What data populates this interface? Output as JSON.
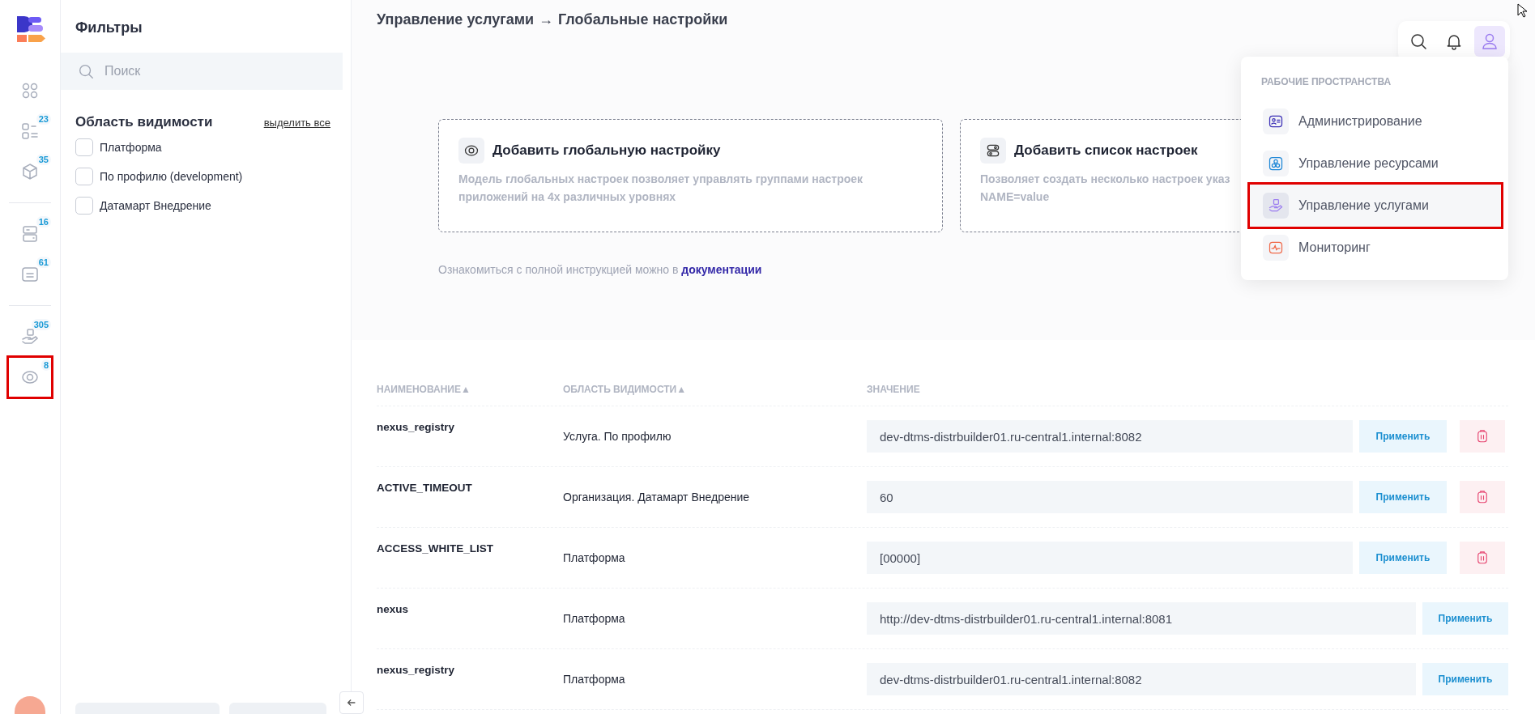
{
  "rail": {
    "groups": [
      [
        {
          "kind": "grid",
          "highlighted": false
        },
        {
          "kind": "list",
          "badge": "23",
          "highlighted": false
        },
        {
          "kind": "cube",
          "badge": "35",
          "highlighted": false
        }
      ],
      [
        {
          "kind": "server",
          "badge": "16",
          "highlighted": false
        },
        {
          "kind": "terminal",
          "badge": "61",
          "highlighted": false
        }
      ],
      [
        {
          "kind": "hand",
          "badge": "305",
          "highlighted": false
        },
        {
          "kind": "eye",
          "badge": "8",
          "highlighted": true
        }
      ]
    ]
  },
  "filters": {
    "title": "Фильтры",
    "search": {
      "placeholder": "Поиск"
    },
    "section": "Область видимости",
    "select_all": "выделить все",
    "options": [
      {
        "label": "Платформа",
        "checked": false
      },
      {
        "label": "По профилю (development)",
        "checked": false
      },
      {
        "label": "Датамарт Внедрение",
        "checked": false
      }
    ]
  },
  "breadcrumb": {
    "parent": "Управление услугами",
    "separator": "→",
    "current": "Глобальные настройки"
  },
  "cards": [
    {
      "kind": "eye",
      "title": "Добавить глобальную настройку",
      "lines": [
        "Модель глобальных настроек позволяет управлять группами настроек",
        "приложений на 4х различных уровнях"
      ]
    },
    {
      "kind": "toggles",
      "title": "Добавить список настроек",
      "lines": [
        "Позволяет создать несколько настроек указ",
        "NAME=value"
      ]
    }
  ],
  "docs": {
    "text": "Ознакомиться с полной инструкцией можно в",
    "link": "документации"
  },
  "toolbar": [
    {
      "kind": "search",
      "selected": false
    },
    {
      "kind": "bell",
      "selected": false
    },
    {
      "kind": "user",
      "selected": true
    }
  ],
  "menu": {
    "section": "РАБОЧИЕ ПРОСТРАНСТВА",
    "items": [
      {
        "kind": "admin",
        "label": "Администрирование",
        "selected": false,
        "highlighted": false
      },
      {
        "kind": "resources",
        "label": "Управление ресурсами",
        "selected": false,
        "highlighted": false
      },
      {
        "kind": "services",
        "label": "Управление услугами",
        "selected": true,
        "highlighted": true
      },
      {
        "kind": "monitoring",
        "label": "Мониторинг",
        "selected": false,
        "highlighted": false
      }
    ]
  },
  "table": {
    "columns": [
      {
        "label": "НАИМЕНОВАНИЕ",
        "sort": "▲"
      },
      {
        "label": "ОБЛАСТЬ ВИДИМОСТИ",
        "sort": "▲"
      },
      {
        "label": "ЗНАЧЕНИЕ"
      }
    ],
    "rows": [
      {
        "name": "nexus_registry",
        "scope": "Услуга. По профилю",
        "value": "dev-dtms-distrbuilder01.ru-central1.internal:8082",
        "apply": "Применить",
        "deletable": true
      },
      {
        "name": "ACTIVE_TIMEOUT",
        "scope": "Организация. Датамарт Внедрение",
        "value": "60",
        "apply": "Применить",
        "deletable": true
      },
      {
        "name": "ACCESS_WHITE_LIST",
        "scope": "Платформа",
        "value": "[00000]",
        "apply": "Применить",
        "deletable": true
      },
      {
        "name": "nexus",
        "scope": "Платформа",
        "value": "http://dev-dtms-distrbuilder01.ru-central1.internal:8081",
        "apply": "Применить",
        "deletable": false
      },
      {
        "name": "nexus_registry",
        "scope": "Платформа",
        "value": "dev-dtms-distrbuilder01.ru-central1.internal:8082",
        "apply": "Применить",
        "deletable": false
      }
    ]
  }
}
